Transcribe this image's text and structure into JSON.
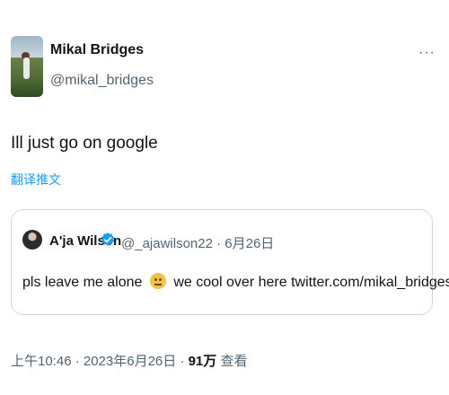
{
  "author": {
    "name": "Mikal Bridges",
    "handle": "@mikal_bridges"
  },
  "more_icon": "more-horizontal-icon",
  "tweet_text": "Ill just go on google",
  "translate_label": "翻译推文",
  "quote": {
    "name": "A'ja Wilson",
    "verified": true,
    "meta": "@_ajawilson22 · 6月26日",
    "text_before": "pls leave me alone",
    "emoji": "neutral-face-emoji",
    "text_after": "we cool over here twitter.com/mikal_bridges/..."
  },
  "footer": {
    "time_date": "上午10:46 · 2023年6月26日 · ",
    "views_count": "91万",
    "views_label": " 查看"
  },
  "colors": {
    "link": "#1d9bf0",
    "muted": "#536471",
    "text": "#0f1419",
    "border": "#cfd9de"
  }
}
